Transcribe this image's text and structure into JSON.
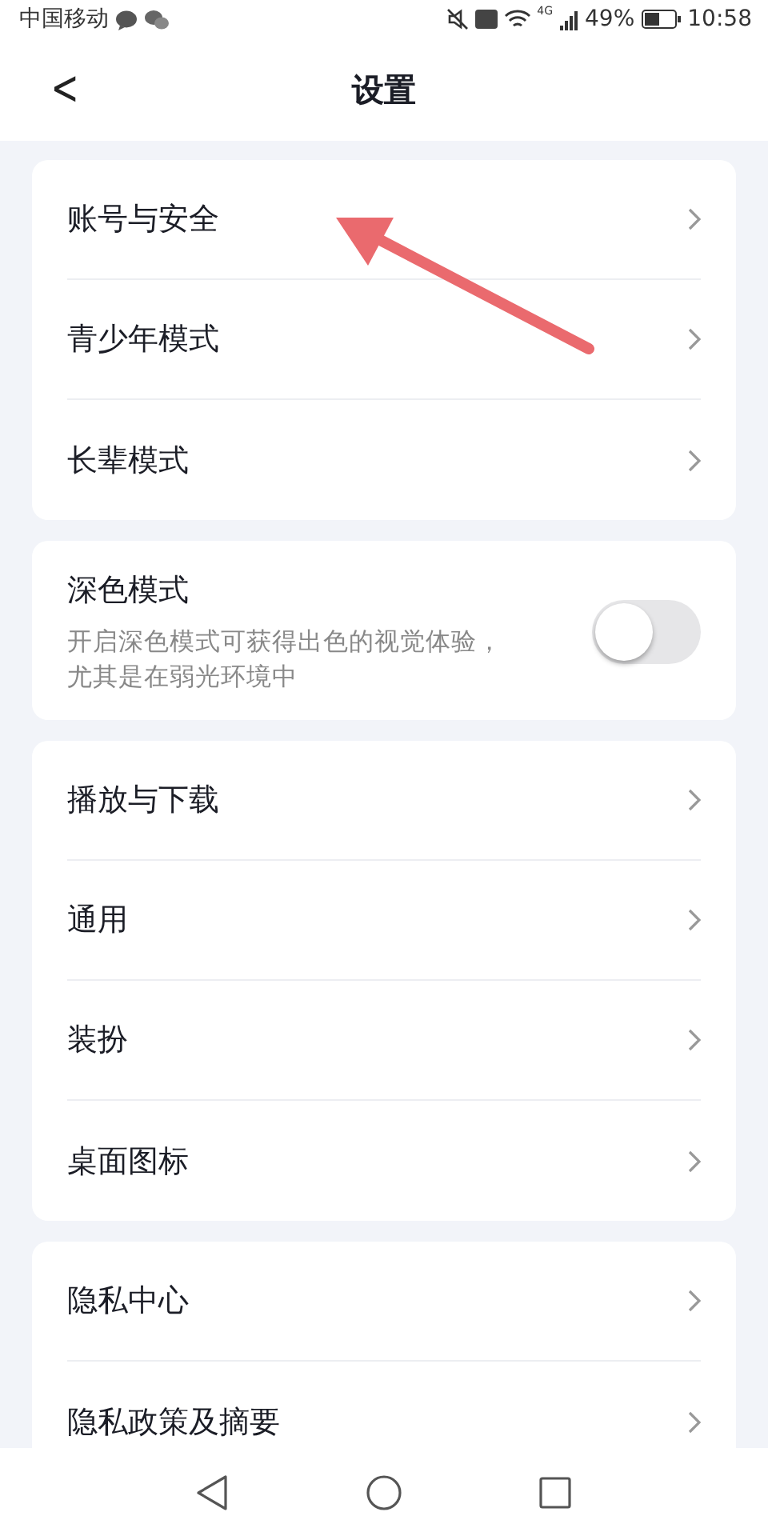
{
  "status_bar": {
    "carrier": "中国移动",
    "battery": "49%",
    "network": "4G",
    "time": "10:58"
  },
  "header": {
    "back": "<",
    "title": "设置"
  },
  "groups": [
    {
      "items": [
        {
          "kind": "link",
          "label": "账号与安全"
        },
        {
          "kind": "link",
          "label": "青少年模式"
        },
        {
          "kind": "link",
          "label": "长辈模式"
        }
      ]
    },
    {
      "items": [
        {
          "kind": "toggle",
          "label": "深色模式",
          "description": "开启深色模式可获得出色的视觉体验，尤其是在弱光环境中",
          "on": false
        }
      ]
    },
    {
      "items": [
        {
          "kind": "link",
          "label": "播放与下载"
        },
        {
          "kind": "link",
          "label": "通用"
        },
        {
          "kind": "link",
          "label": "装扮"
        },
        {
          "kind": "link",
          "label": "桌面图标"
        }
      ]
    },
    {
      "items": [
        {
          "kind": "link",
          "label": "隐私中心"
        },
        {
          "kind": "link",
          "label": "隐私政策及摘要"
        }
      ]
    }
  ]
}
